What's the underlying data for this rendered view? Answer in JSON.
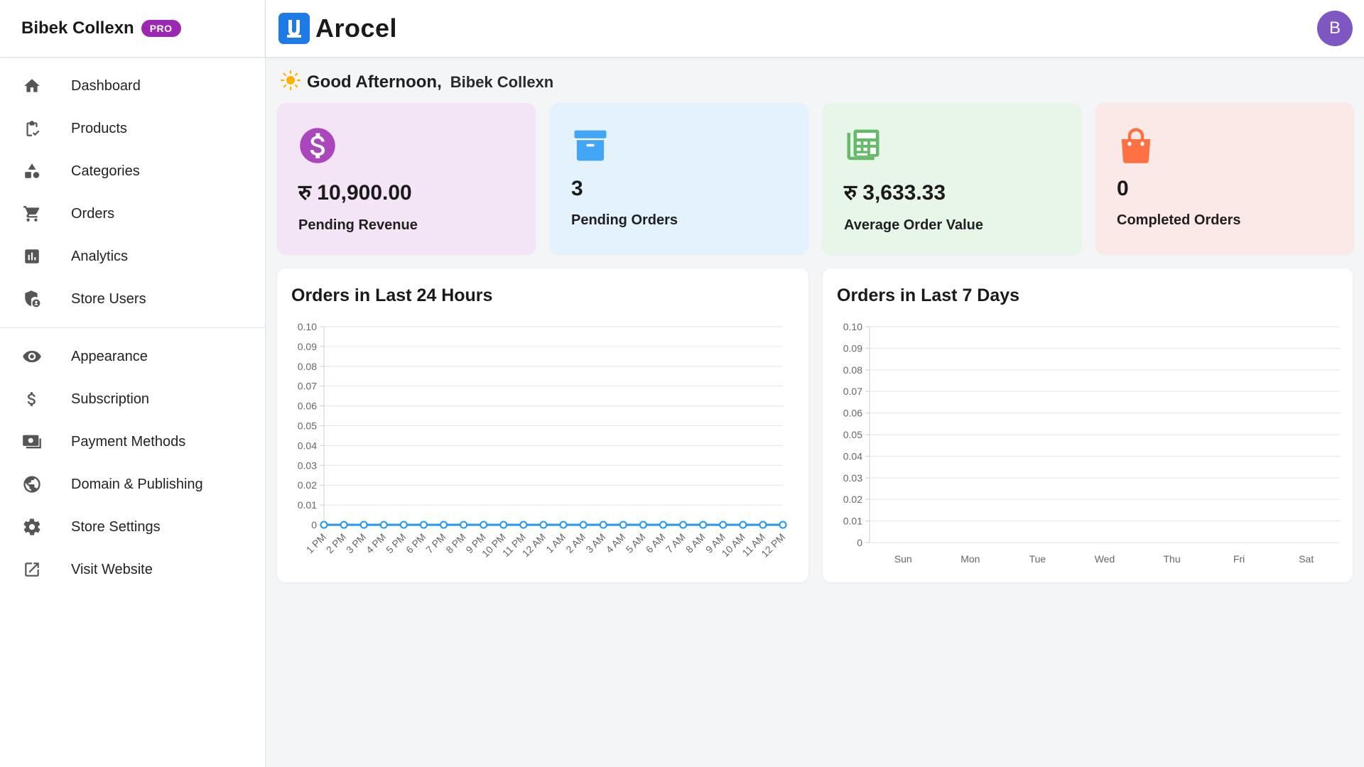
{
  "sidebar": {
    "brand_name": "Bibek Collexn",
    "badge": "PRO",
    "items_main": [
      {
        "label": "Dashboard",
        "icon": "home-icon"
      },
      {
        "label": "Products",
        "icon": "clipboard-check-icon"
      },
      {
        "label": "Categories",
        "icon": "shapes-icon"
      },
      {
        "label": "Orders",
        "icon": "cart-icon"
      },
      {
        "label": "Analytics",
        "icon": "bar-chart-icon"
      },
      {
        "label": "Store Users",
        "icon": "shield-user-icon"
      }
    ],
    "items_settings": [
      {
        "label": "Appearance",
        "icon": "eye-icon"
      },
      {
        "label": "Subscription",
        "icon": "dollar-icon"
      },
      {
        "label": "Payment Methods",
        "icon": "cash-icon"
      },
      {
        "label": "Domain & Publishing",
        "icon": "globe-icon"
      },
      {
        "label": "Store Settings",
        "icon": "gear-icon"
      },
      {
        "label": "Visit Website",
        "icon": "external-link-icon"
      }
    ]
  },
  "topbar": {
    "logo_text": "Arocel",
    "avatar_initial": "B"
  },
  "greeting": {
    "text": "Good Afternoon,",
    "user_name": "Bibek Collexn"
  },
  "stats": [
    {
      "value": "रु 10,900.00",
      "label": "Pending Revenue",
      "icon": "dollar-circle-icon",
      "bg": "#f3e5f5",
      "accent": "#ab47bc"
    },
    {
      "value": "3",
      "label": "Pending Orders",
      "icon": "archive-box-icon",
      "bg": "#e3f2fd",
      "accent": "#42a5f5"
    },
    {
      "value": "रु 3,633.33",
      "label": "Average Order Value",
      "icon": "calculator-icon",
      "bg": "#e8f5e9",
      "accent": "#66bb6a"
    },
    {
      "value": "0",
      "label": "Completed Orders",
      "icon": "shopping-bag-icon",
      "bg": "#fbe9e7",
      "accent": "#ff7043"
    }
  ],
  "colors": {
    "line": "#2196f3",
    "grid": "#e6e6e6",
    "tick_text": "#666666"
  },
  "chart_data": [
    {
      "type": "line",
      "title": "Orders in Last 24 Hours",
      "categories": [
        "1 PM",
        "2 PM",
        "3 PM",
        "4 PM",
        "5 PM",
        "6 PM",
        "7 PM",
        "8 PM",
        "9 PM",
        "10 PM",
        "11 PM",
        "12 AM",
        "1 AM",
        "2 AM",
        "3 AM",
        "4 AM",
        "5 AM",
        "6 AM",
        "7 AM",
        "8 AM",
        "9 AM",
        "10 AM",
        "11 AM",
        "12 PM"
      ],
      "values": [
        0,
        0,
        0,
        0,
        0,
        0,
        0,
        0,
        0,
        0,
        0,
        0,
        0,
        0,
        0,
        0,
        0,
        0,
        0,
        0,
        0,
        0,
        0,
        0
      ],
      "y_ticks": [
        "0",
        "0.01",
        "0.02",
        "0.03",
        "0.04",
        "0.05",
        "0.06",
        "0.07",
        "0.08",
        "0.09",
        "0.10"
      ],
      "ylim": [
        0,
        0.1
      ],
      "grid": true
    },
    {
      "type": "line",
      "title": "Orders in Last 7 Days",
      "categories": [
        "Sun",
        "Mon",
        "Tue",
        "Wed",
        "Thu",
        "Fri",
        "Sat"
      ],
      "values": [],
      "y_ticks": [
        "0",
        "0.01",
        "0.02",
        "0.03",
        "0.04",
        "0.05",
        "0.06",
        "0.07",
        "0.08",
        "0.09",
        "0.10"
      ],
      "ylim": [
        0,
        0.1
      ],
      "grid": true
    }
  ]
}
